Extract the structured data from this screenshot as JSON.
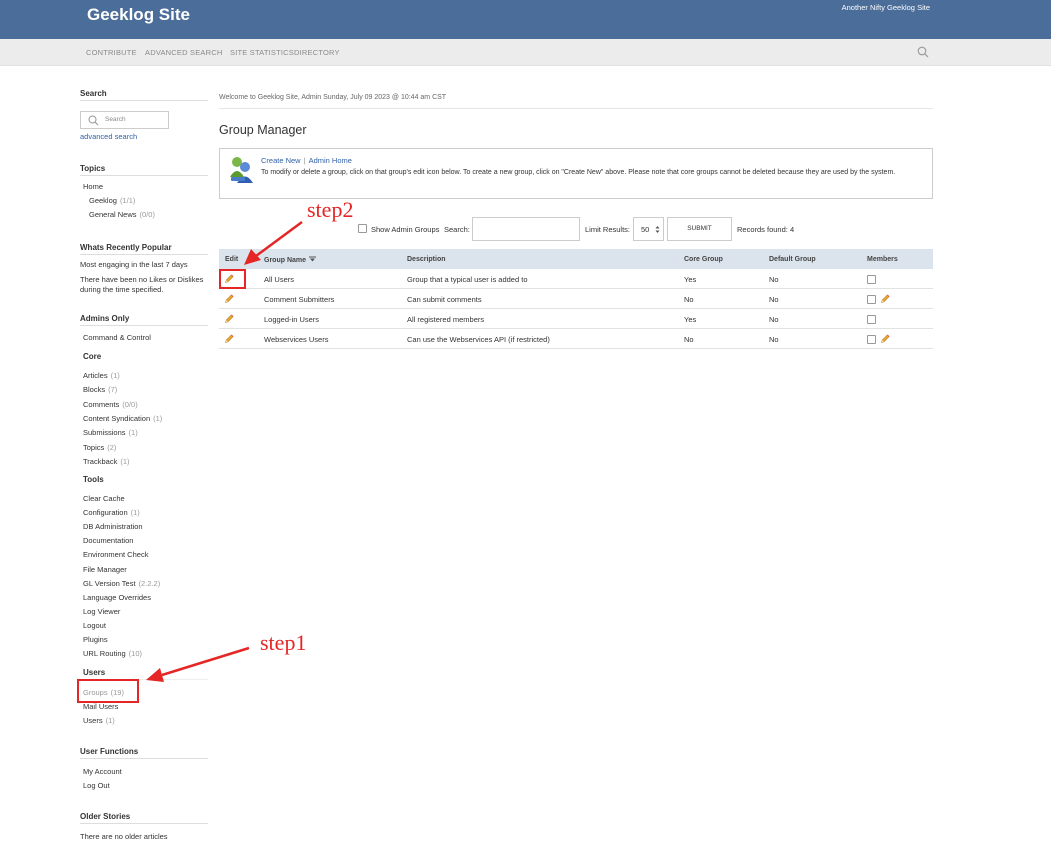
{
  "header": {
    "title": "Geeklog Site",
    "slogan": "Another Nifty Geeklog Site"
  },
  "nav": {
    "items": [
      "CONTRIBUTE",
      "ADVANCED SEARCH",
      "SITE STATISTICS",
      "DIRECTORY"
    ]
  },
  "sidebar": {
    "search": {
      "title": "Search",
      "placeholder": "Search",
      "advanced": "advanced search"
    },
    "topics": {
      "title": "Topics",
      "home": "Home",
      "items": [
        {
          "label": "Geeklog",
          "count": "(1/1)"
        },
        {
          "label": "General News",
          "count": "(0/0)"
        }
      ]
    },
    "popular": {
      "title": "Whats Recently Popular",
      "line1": "Most engaging in the last 7 days",
      "line2": "There have been no Likes or Dislikes",
      "line3": "during the time specified."
    },
    "admins": {
      "title": "Admins Only",
      "command": "Command & Control",
      "core_title": "Core",
      "core": [
        {
          "label": "Articles",
          "count": "(1)"
        },
        {
          "label": "Blocks",
          "count": "(7)"
        },
        {
          "label": "Comments",
          "count": "(0/0)"
        },
        {
          "label": "Content Syndication",
          "count": "(1)"
        },
        {
          "label": "Submissions",
          "count": "(1)"
        },
        {
          "label": "Topics",
          "count": "(2)"
        },
        {
          "label": "Trackback",
          "count": "(1)"
        }
      ],
      "tools_title": "Tools",
      "tools": [
        {
          "label": "Clear Cache",
          "count": ""
        },
        {
          "label": "Configuration",
          "count": "(1)"
        },
        {
          "label": "DB Administration",
          "count": ""
        },
        {
          "label": "Documentation",
          "count": ""
        },
        {
          "label": "Environment Check",
          "count": ""
        },
        {
          "label": "File Manager",
          "count": ""
        },
        {
          "label": "GL Version Test",
          "count": "(2.2.2)"
        },
        {
          "label": "Language Overrides",
          "count": ""
        },
        {
          "label": "Log Viewer",
          "count": ""
        },
        {
          "label": "Logout",
          "count": ""
        },
        {
          "label": "Plugins",
          "count": ""
        },
        {
          "label": "URL Routing",
          "count": "(10)"
        }
      ],
      "users_title": "Users",
      "users": [
        {
          "label": "Groups",
          "count": "(19)"
        },
        {
          "label": "Mail Users",
          "count": ""
        },
        {
          "label": "Users",
          "count": "(1)"
        }
      ]
    },
    "user_functions": {
      "title": "User Functions",
      "items": [
        "My Account",
        "Log Out"
      ]
    },
    "older": {
      "title": "Older Stories",
      "text": "There are no older articles"
    }
  },
  "main": {
    "welcome": "Welcome to Geeklog Site, Admin Sunday, July 09 2023 @ 10:44 am CST",
    "title": "Group Manager",
    "info": {
      "create_new": "Create New",
      "separator": "|",
      "admin_home": "Admin Home",
      "description": "To modify or delete a group, click on that group's edit icon below. To create a new group, click on \"Create New\" above. Please note that core groups cannot be deleted because they are used by the system."
    },
    "filter": {
      "show_admin": "Show Admin Groups",
      "search_label": "Search:",
      "search_value": "",
      "limit_label": "Limit Results:",
      "limit_value": "50",
      "submit": "SUBMIT",
      "records": "Records found: 4"
    },
    "table": {
      "headers": [
        "Edit",
        "Group Name",
        "Description",
        "Core Group",
        "Default Group",
        "Members"
      ],
      "rows": [
        {
          "name": "All Users",
          "desc": "Group that a typical user is added to",
          "core": "Yes",
          "default": "No",
          "edit_members": false
        },
        {
          "name": "Comment Submitters",
          "desc": "Can submit comments",
          "core": "No",
          "default": "No",
          "edit_members": true
        },
        {
          "name": "Logged-in Users",
          "desc": "All registered members",
          "core": "Yes",
          "default": "No",
          "edit_members": false
        },
        {
          "name": "Webservices Users",
          "desc": "Can use the Webservices API (if restricted)",
          "core": "No",
          "default": "No",
          "edit_members": true
        }
      ]
    }
  },
  "annotations": {
    "step1": "step1",
    "step2": "step2",
    "color": "#e52626"
  }
}
